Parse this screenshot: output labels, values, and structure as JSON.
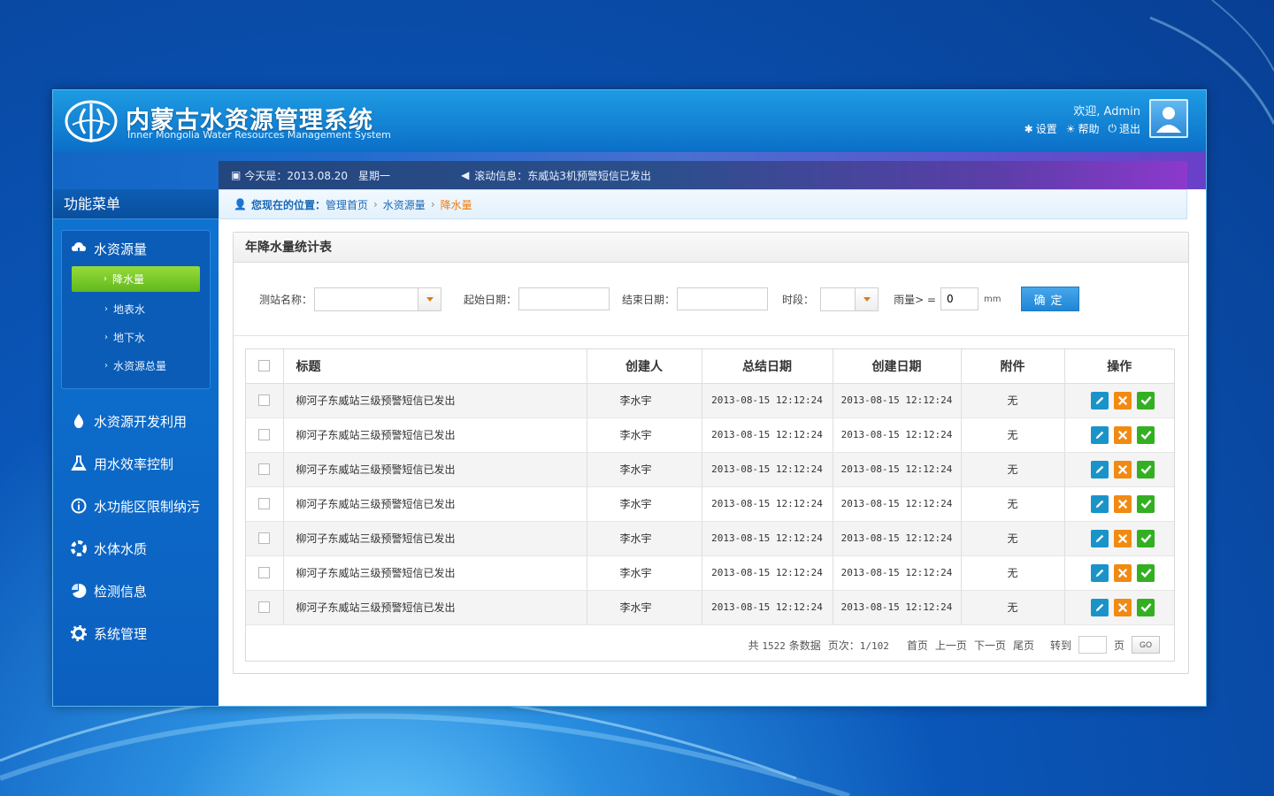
{
  "header": {
    "title_cn": "内蒙古水资源管理系统",
    "title_en": "Inner Mongolia Water Resources Management System",
    "welcome": "欢迎, Admin",
    "links": [
      {
        "icon": "gear-icon",
        "label": "设置"
      },
      {
        "icon": "sun-icon",
        "label": "帮助"
      },
      {
        "icon": "power-icon",
        "label": "退出"
      }
    ]
  },
  "infobar": {
    "date": "今天是：2013.08.20　星期一",
    "scroll": "滚动信息：东威站3机预警短信已发出"
  },
  "sidebar": {
    "title": "功能菜单",
    "group": {
      "label": "水资源量",
      "items": [
        "降水量",
        "地表水",
        "地下水",
        "水资源总量"
      ]
    },
    "items": [
      {
        "icon": "water-drop-icon",
        "label": "水资源开发利用"
      },
      {
        "icon": "flask-icon",
        "label": "用水效率控制"
      },
      {
        "icon": "info-icon",
        "label": "水功能区限制纳污"
      },
      {
        "icon": "lifebuoy-icon",
        "label": "水体水质"
      },
      {
        "icon": "pie-chart-icon",
        "label": "检测信息"
      },
      {
        "icon": "gear-icon",
        "label": "系统管理"
      }
    ]
  },
  "breadcrumb": {
    "label": "您现在的位置：",
    "items": [
      "管理首页",
      "水资源量",
      "降水量"
    ]
  },
  "panel": {
    "title": "年降水量统计表",
    "filters": {
      "station_label": "测站名称：",
      "station_value": "",
      "start_label": "起始日期：",
      "start_value": "",
      "end_label": "结束日期：",
      "end_value": "",
      "period_label": "时段：",
      "period_value": "",
      "rain_label": "雨量> =",
      "rain_value": "0",
      "rain_unit": "mm",
      "confirm": "确定"
    }
  },
  "table": {
    "headers": [
      "标题",
      "创建人",
      "总结日期",
      "创建日期",
      "附件",
      "操作"
    ],
    "rows": [
      {
        "title": "柳河子东威站三级预警短信已发出",
        "creator": "李水宇",
        "summary_date": "2013-08-15 12:12:24",
        "create_date": "2013-08-15 12:12:24",
        "attachment": "无"
      },
      {
        "title": "柳河子东威站三级预警短信已发出",
        "creator": "李水宇",
        "summary_date": "2013-08-15 12:12:24",
        "create_date": "2013-08-15 12:12:24",
        "attachment": "无"
      },
      {
        "title": "柳河子东威站三级预警短信已发出",
        "creator": "李水宇",
        "summary_date": "2013-08-15 12:12:24",
        "create_date": "2013-08-15 12:12:24",
        "attachment": "无"
      },
      {
        "title": "柳河子东威站三级预警短信已发出",
        "creator": "李水宇",
        "summary_date": "2013-08-15 12:12:24",
        "create_date": "2013-08-15 12:12:24",
        "attachment": "无"
      },
      {
        "title": "柳河子东威站三级预警短信已发出",
        "creator": "李水宇",
        "summary_date": "2013-08-15 12:12:24",
        "create_date": "2013-08-15 12:12:24",
        "attachment": "无"
      },
      {
        "title": "柳河子东威站三级预警短信已发出",
        "creator": "李水宇",
        "summary_date": "2013-08-15 12:12:24",
        "create_date": "2013-08-15 12:12:24",
        "attachment": "无"
      },
      {
        "title": "柳河子东威站三级预警短信已发出",
        "creator": "李水宇",
        "summary_date": "2013-08-15 12:12:24",
        "create_date": "2013-08-15 12:12:24",
        "attachment": "无"
      }
    ]
  },
  "pager": {
    "total_prefix": "共",
    "total": "1522",
    "total_suffix": "条数据",
    "pages_label": "页次：",
    "pages": "1/102",
    "first": "首页",
    "prev": "上一页",
    "next": "下一页",
    "last": "尾页",
    "goto_label": "转到",
    "goto_value": "",
    "page_unit": "页",
    "go": "GO"
  },
  "colors": {
    "accent": "#1a94c8",
    "active_menu": "#7ccb2c",
    "delete": "#f18a13",
    "approve": "#33b022",
    "breadcrumb_current": "#f07c10"
  }
}
